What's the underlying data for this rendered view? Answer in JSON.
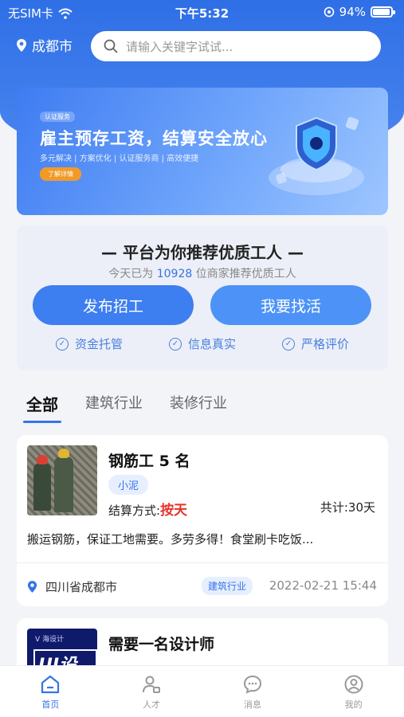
{
  "status_bar": {
    "carrier": "无SIM卡",
    "time": "下午5:32",
    "battery": "94%",
    "battery_level": 0.94
  },
  "header": {
    "city": "成都市",
    "search_placeholder": "请输入关键字试试..."
  },
  "banner": {
    "tag": "认证服务",
    "title": "雇主预存工资，结算安全放心",
    "subtitle": "多元解决 | 方案优化 | 认证服务商 | 高效便捷",
    "button": "了解详情"
  },
  "recommend": {
    "title": "— 平台为你推荐优质工人 —",
    "sub_prefix": "今天已为",
    "count": "10928",
    "sub_suffix": "位商家推荐优质工人",
    "publish_button": "发布招工",
    "find_button": "我要找活",
    "features": [
      "资金托管",
      "信息真实",
      "严格评价"
    ]
  },
  "category_tabs": [
    "全部",
    "建筑行业",
    "装修行业"
  ],
  "jobs": [
    {
      "title": "钢筋工 5 名",
      "tag": "小泥",
      "settle_label": "结算方式:",
      "settle_value": "按天",
      "total": "共计:30天",
      "description": "搬运钢筋，保证工地需要。多劳多得！食堂刷卡吃饭...",
      "location": "四川省成都市",
      "industry": "建筑行业",
      "date": "2022-02-21 15:44"
    },
    {
      "title": "需要一名设计师",
      "thumb_text": "UI设计",
      "thumb_logo": "V 海设计"
    }
  ],
  "tabbar": [
    "首页",
    "人才",
    "消息",
    "我的"
  ],
  "colors": {
    "primary": "#3573e8",
    "accent_red": "#e6342a",
    "banner_button": "#f29a28"
  }
}
